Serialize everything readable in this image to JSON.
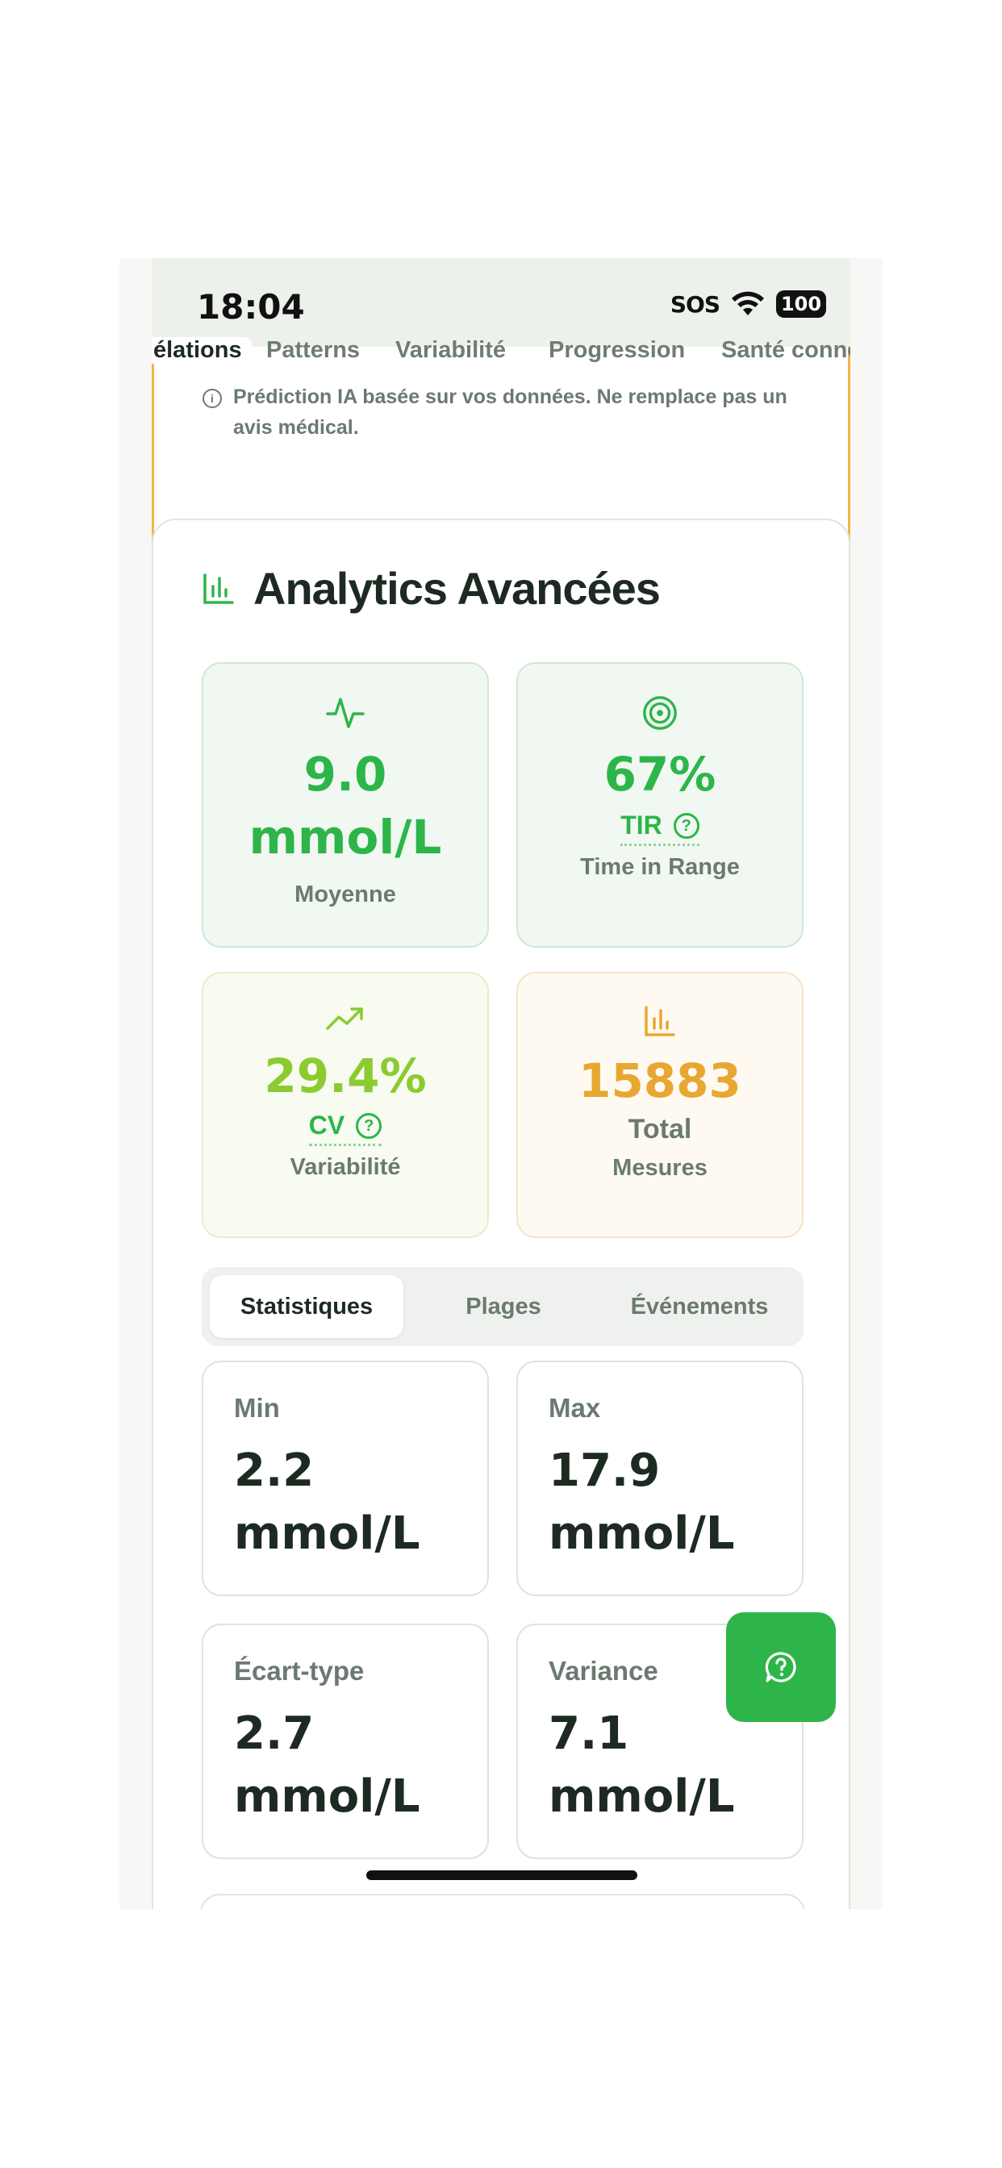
{
  "status_bar": {
    "time": "18:04",
    "sos": "SOS",
    "battery": "100"
  },
  "top_tabs": [
    "élations",
    "Patterns",
    "Variabilité",
    "Progression",
    "Santé conne"
  ],
  "banner": {
    "note": "Prédiction IA basée sur vos données. Ne remplace pas un avis médical."
  },
  "analytics": {
    "title": "Analytics Avancées",
    "kpis": {
      "mean": {
        "value": "9.0 mmol/L",
        "label": "Moyenne"
      },
      "tir": {
        "value": "67%",
        "abbr": "TIR",
        "label": "Time in Range"
      },
      "cv": {
        "value": "29.4%",
        "abbr": "CV",
        "label": "Variabilité"
      },
      "total": {
        "value": "15883",
        "label": "Total",
        "sublabel": "Mesures"
      }
    },
    "segmented": {
      "tabs": [
        "Statistiques",
        "Plages",
        "Événements"
      ],
      "active": "Statistiques"
    },
    "stats": [
      {
        "label": "Min",
        "value": "2.2 mmol/L"
      },
      {
        "label": "Max",
        "value": "17.9 mmol/L"
      },
      {
        "label": "Écart-type",
        "value": "2.7 mmol/L"
      },
      {
        "label": "Variance",
        "value": "7.1 mmol/L"
      }
    ]
  },
  "colors": {
    "green": "#2db54a",
    "lime": "#8bcb2f",
    "amber": "#e8a732",
    "dark": "#1d2a22",
    "muted": "#6b7a70"
  }
}
